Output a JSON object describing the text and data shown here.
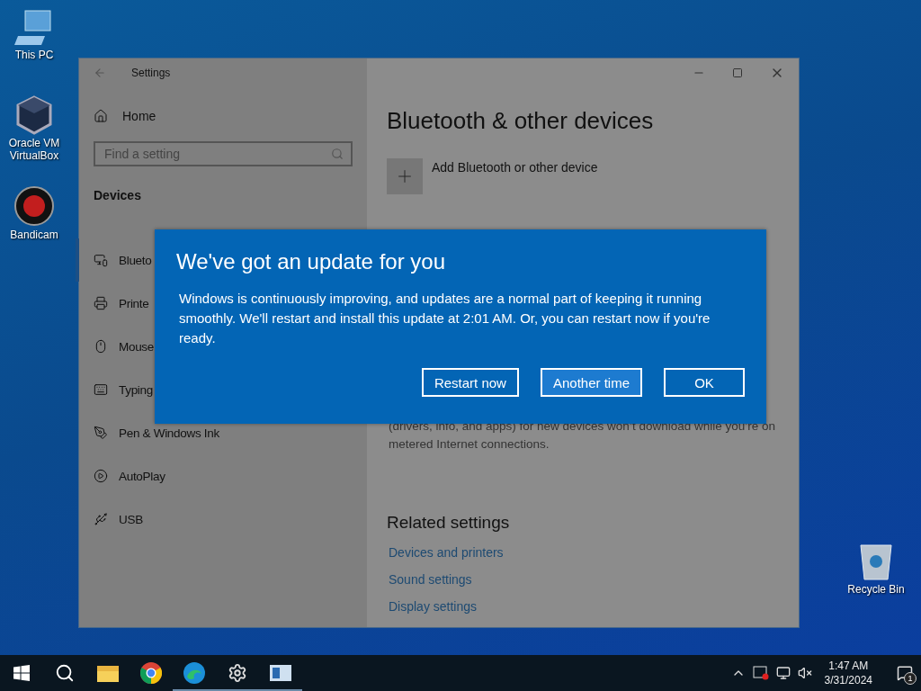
{
  "desktop_icons": [
    {
      "label": "This PC",
      "kind": "pc"
    },
    {
      "label": "Oracle VM VirtualBox",
      "kind": "virtualbox"
    },
    {
      "label": "Bandicam",
      "kind": "bandicam"
    },
    {
      "label": "Recycle Bin",
      "kind": "recycle"
    }
  ],
  "window": {
    "title": "Settings",
    "home": "Home",
    "search": {
      "placeholder": "Find a setting"
    },
    "section": "Devices",
    "sidebar_items": [
      {
        "label": "Blueto",
        "kind": "devices",
        "selected": true
      },
      {
        "label": "Printe",
        "kind": "printer",
        "selected": false
      },
      {
        "label": "Mouse",
        "kind": "mouse",
        "selected": false
      },
      {
        "label": "Typing",
        "kind": "keyboard",
        "selected": false
      },
      {
        "label": "Pen & Windows Ink",
        "kind": "pen",
        "selected": false
      },
      {
        "label": "AutoPlay",
        "kind": "autoplay",
        "selected": false
      },
      {
        "label": "USB",
        "kind": "usb",
        "selected": false
      }
    ],
    "content": {
      "title": "Bluetooth & other devices",
      "add_device": "Add Bluetooth or other device",
      "note": "(drivers, info, and apps) for new devices won’t download while you’re on metered Internet connections.",
      "related_title": "Related settings",
      "links": [
        "Devices and printers",
        "Sound settings",
        "Display settings"
      ]
    }
  },
  "dialog": {
    "title": "We've got an update for you",
    "body": "Windows is continuously improving, and updates are a normal part of keeping it running smoothly. We'll restart and install this update at 2:01 AM. Or, you can restart now if you're ready.",
    "buttons": [
      {
        "label": "Restart now",
        "focused": false
      },
      {
        "label": "Another time",
        "focused": true
      },
      {
        "label": "OK",
        "focused": false
      }
    ]
  },
  "taskbar": {
    "apps": [
      {
        "kind": "explorer",
        "running": false
      },
      {
        "kind": "chrome",
        "running": false
      },
      {
        "kind": "edge",
        "running": true
      },
      {
        "kind": "settings",
        "running": true
      },
      {
        "kind": "window",
        "running": true
      }
    ],
    "time": "1:47 AM",
    "date": "3/31/2024",
    "notifications": "1"
  }
}
